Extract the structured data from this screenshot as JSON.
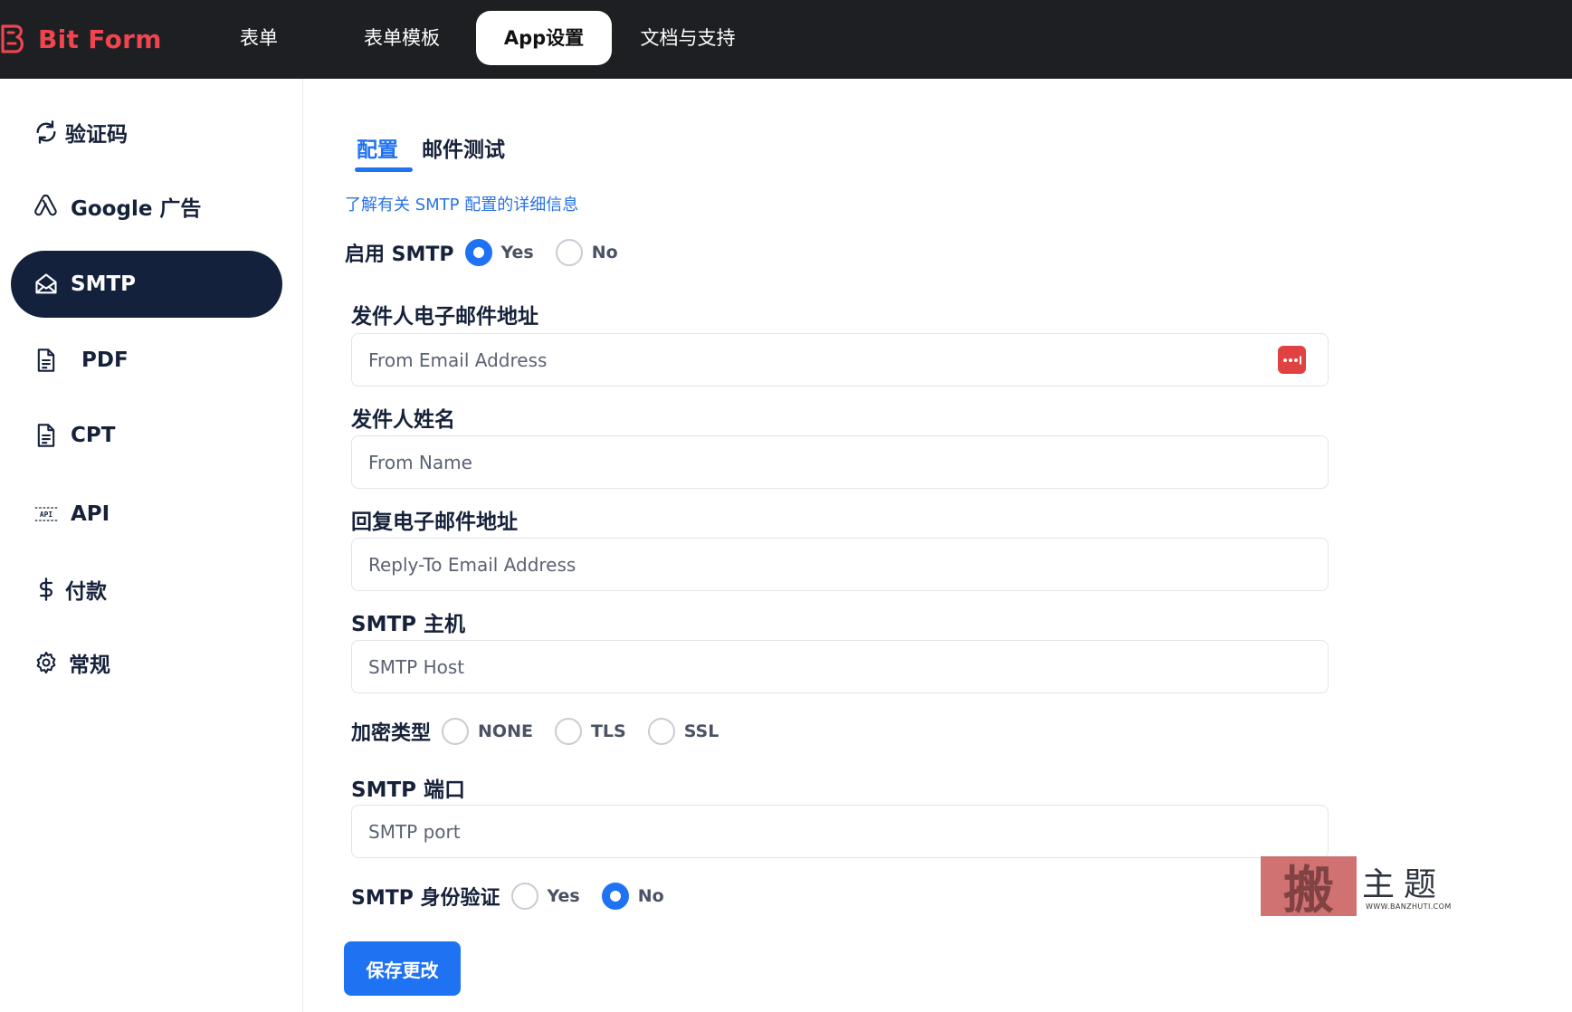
{
  "brand": {
    "name": "Bit Form",
    "color": "#f0454f"
  },
  "nav": {
    "items": [
      {
        "label": "表单"
      },
      {
        "label": "表单模板"
      },
      {
        "label": "App设置",
        "active": true
      },
      {
        "label": "文档与支持"
      }
    ]
  },
  "sidebar": {
    "items": [
      {
        "label": "验证码",
        "icon": "recaptcha-icon"
      },
      {
        "label": "Google 广告",
        "icon": "google-ads-icon"
      },
      {
        "label": "SMTP",
        "icon": "mail-open-icon",
        "active": true
      },
      {
        "label": "PDF",
        "icon": "document-icon"
      },
      {
        "label": "CPT",
        "icon": "document-icon"
      },
      {
        "label": "API",
        "icon": "api-icon"
      },
      {
        "label": "付款",
        "icon": "dollar-icon"
      },
      {
        "label": "常规",
        "icon": "gear-icon"
      }
    ]
  },
  "tabs": [
    {
      "label": "配置",
      "active": true
    },
    {
      "label": "邮件测试"
    }
  ],
  "learn_link": "了解有关 SMTP 配置的详细信息",
  "enable_smtp": {
    "label": "启用 SMTP",
    "yes": "Yes",
    "no": "No",
    "selected": "yes"
  },
  "fields": {
    "from_email": {
      "label": "发件人电子邮件地址",
      "placeholder": "From Email Address",
      "value": ""
    },
    "from_name": {
      "label": "发件人姓名",
      "placeholder": "From Name",
      "value": ""
    },
    "reply_to": {
      "label": "回复电子邮件地址",
      "placeholder": "Reply-To Email Address",
      "value": ""
    },
    "smtp_host": {
      "label": "SMTP 主机",
      "placeholder": "SMTP Host",
      "value": ""
    },
    "smtp_port": {
      "label": "SMTP 端口",
      "placeholder": "SMTP port",
      "value": ""
    }
  },
  "encryption": {
    "label": "加密类型",
    "options": [
      "NONE",
      "TLS",
      "SSL"
    ],
    "selected": ""
  },
  "smtp_auth": {
    "label": "SMTP 身份验证",
    "yes": "Yes",
    "no": "No",
    "selected": "no"
  },
  "save_button": "保存更改",
  "watermark": {
    "stamp": "搬",
    "text": "主题",
    "url": "WWW.BANZHUTI.COM"
  },
  "colors": {
    "accent": "#1f72f2",
    "sidebar_active": "#14213d",
    "topbar": "#1d1f22"
  }
}
